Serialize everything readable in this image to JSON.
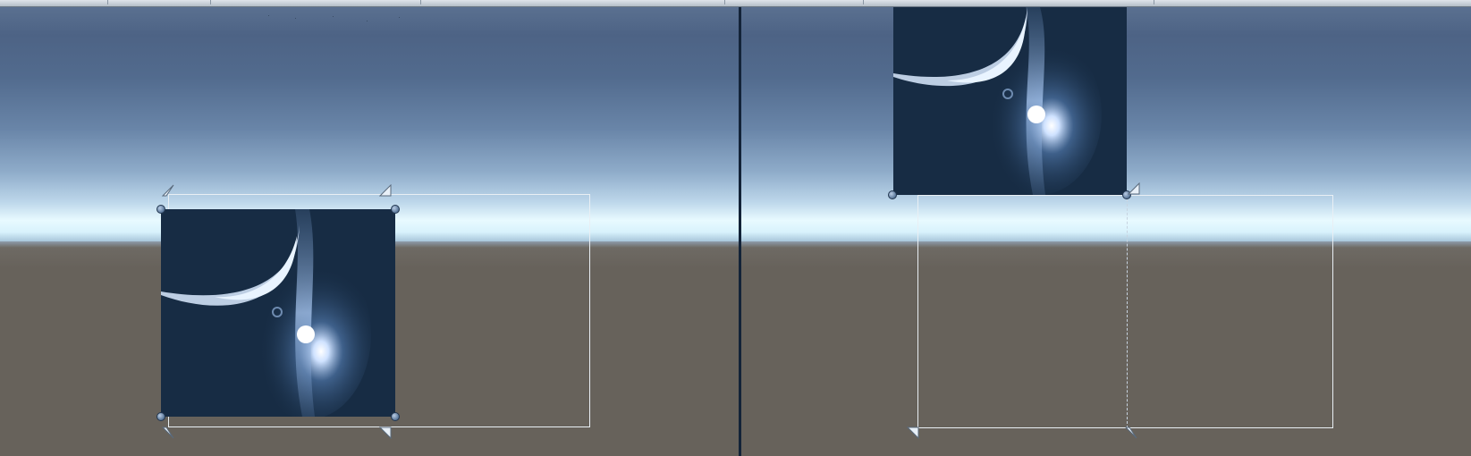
{
  "scene": {
    "panels": [
      "left-scene-view",
      "right-scene-view"
    ],
    "colors": {
      "sky_top": "#4d6385",
      "horizon": "#e8faff",
      "ground": "#67625b",
      "sprite_background": "#172c44",
      "rect_outline": "#e9eff4",
      "handle": "#5f7c9e"
    },
    "icons": [
      "anchor-marker-icon",
      "resize-handle-icon",
      "sprite-image-icon"
    ]
  }
}
